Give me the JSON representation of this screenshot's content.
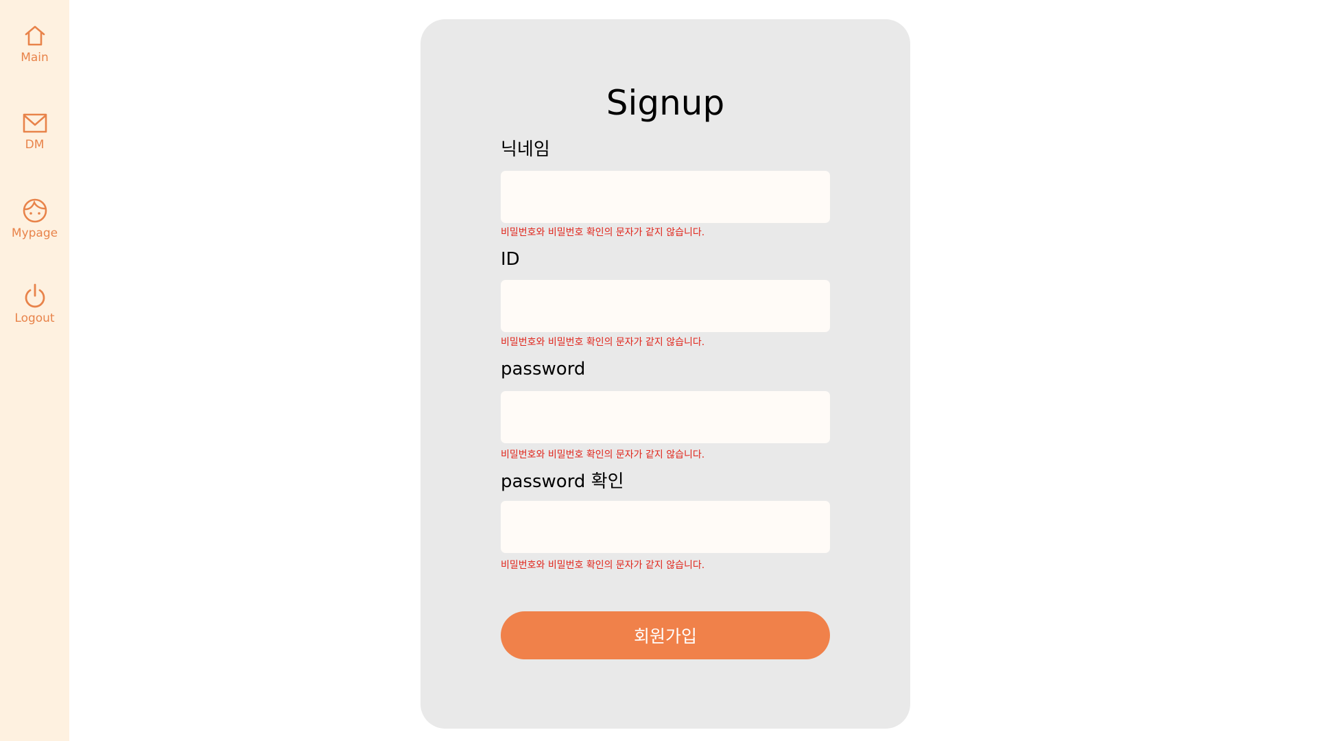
{
  "sidebar": {
    "items": [
      {
        "label": "Main",
        "icon": "home-icon"
      },
      {
        "label": "DM",
        "icon": "mail-icon"
      },
      {
        "label": "Mypage",
        "icon": "face-icon"
      },
      {
        "label": "Logout",
        "icon": "power-icon"
      }
    ],
    "accent_color": "#e8834a",
    "background_color": "#fef1e0"
  },
  "form": {
    "title": "Signup",
    "fields": [
      {
        "label": "닉네임",
        "value": "",
        "error": "비밀번호와 비밀번호 확인의 문자가 같지 않습니다."
      },
      {
        "label": "ID",
        "value": "",
        "error": "비밀번호와 비밀번호 확인의 문자가 같지 않습니다."
      },
      {
        "label": "password",
        "value": "",
        "error": "비밀번호와 비밀번호 확인의 문자가 같지 않습니다."
      },
      {
        "label": "password 확인",
        "value": "",
        "error": "비밀번호와 비밀번호 확인의 문자가 같지 않습니다."
      }
    ],
    "submit_label": "회원가입",
    "button_color": "#f0814a",
    "error_color": "#e0241a"
  }
}
